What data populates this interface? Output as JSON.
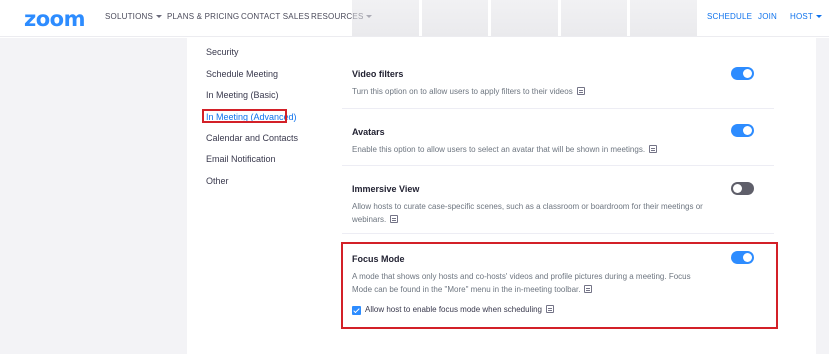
{
  "nav": {
    "logo": "zoom",
    "left_links": [
      "SOLUTIONS",
      "PLANS & PRICING",
      "CONTACT SALES",
      "RESOURCES"
    ],
    "right_links": [
      "SCHEDULE",
      "JOIN",
      "HOST"
    ]
  },
  "sidebar": {
    "items": [
      {
        "label": "Security"
      },
      {
        "label": "Schedule Meeting"
      },
      {
        "label": "In Meeting (Basic)"
      },
      {
        "label": "In Meeting (Advanced)",
        "active": true
      },
      {
        "label": "Calendar and Contacts"
      },
      {
        "label": "Email Notification"
      },
      {
        "label": "Other"
      }
    ]
  },
  "settings": [
    {
      "title": "Video filters",
      "desc": "Turn this option on to allow users to apply filters to their videos",
      "enabled": true
    },
    {
      "title": "Avatars",
      "desc": "Enable this option to allow users to select an avatar that will be shown in meetings.",
      "enabled": true
    },
    {
      "title": "Immersive View",
      "desc": "Allow hosts to curate case-specific scenes, such as a classroom or boardroom for their meetings or webinars.",
      "enabled": false
    },
    {
      "title": "Focus Mode",
      "desc": "A mode that shows only hosts and co-hosts' videos and profile pictures during a meeting. Focus Mode can be found in the \"More\" menu in the in-meeting toolbar.",
      "enabled": true
    }
  ],
  "focus_option": {
    "label": "Allow host to enable focus mode when scheduling",
    "checked": true
  },
  "colors": {
    "accent": "#2d8cff",
    "highlight": "#d32028",
    "toggle_off": "#5f5f6a"
  },
  "icons": {
    "settings_info": "info-icon",
    "nav_dropdown": "chevron-down-icon"
  }
}
